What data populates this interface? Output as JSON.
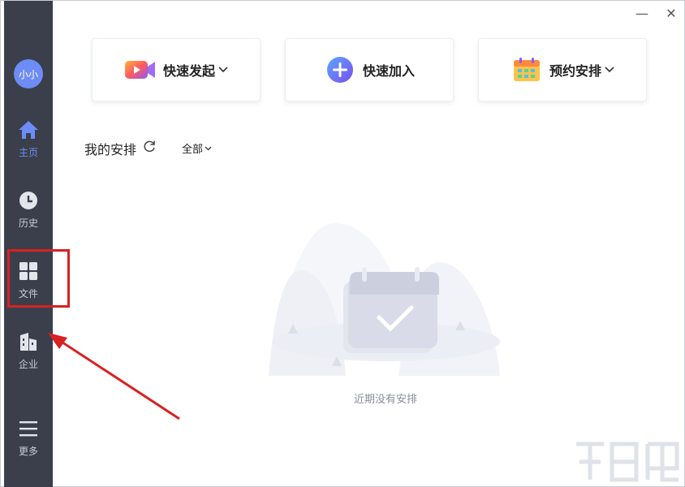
{
  "sidebar": {
    "avatar_text": "小小",
    "items": [
      {
        "label": "主页",
        "icon": "home-icon"
      },
      {
        "label": "历史",
        "icon": "clock-icon"
      },
      {
        "label": "文件",
        "icon": "grid-icon"
      },
      {
        "label": "企业",
        "icon": "building-icon"
      },
      {
        "label": "更多",
        "icon": "menu-icon"
      }
    ]
  },
  "window_controls": {
    "minimize": "—",
    "close": "✕"
  },
  "actions": [
    {
      "label": "快速发起",
      "icon": "video-camera-icon",
      "dropdown": true
    },
    {
      "label": "快速加入",
      "icon": "plus-circle-icon",
      "dropdown": false
    },
    {
      "label": "预约安排",
      "icon": "calendar-icon",
      "dropdown": true
    }
  ],
  "schedule": {
    "title": "我的安排",
    "filter_label": "全部",
    "empty_text": "近期没有安排"
  },
  "colors": {
    "sidebar_bg": "#3a3f4b",
    "accent": "#6d8cf5",
    "annotation_red": "#d92121"
  }
}
